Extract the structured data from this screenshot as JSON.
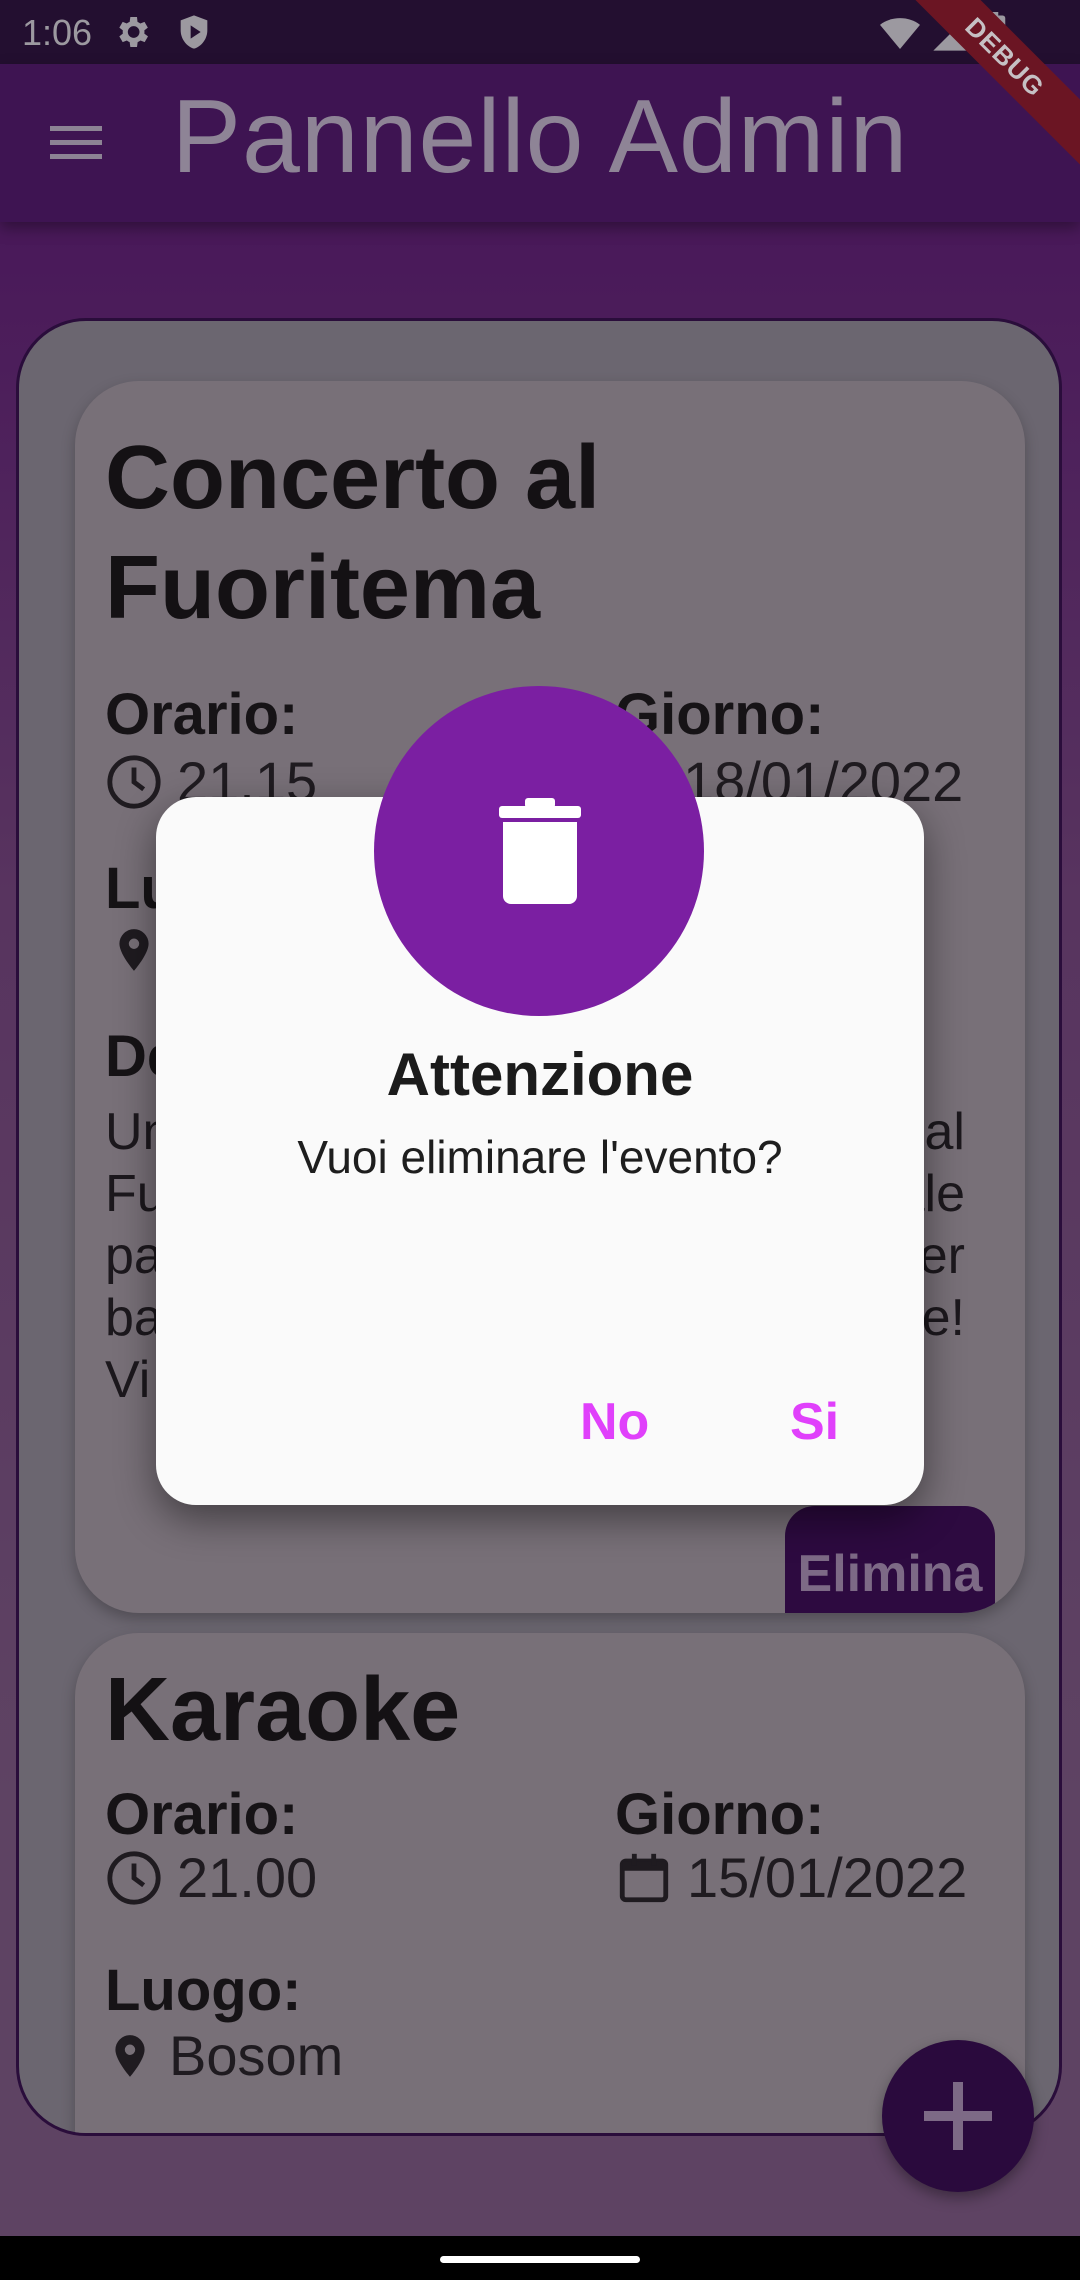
{
  "status_bar": {
    "time": "1:06"
  },
  "debug_banner": "DEBUG",
  "app_bar": {
    "title": "Pannello Admin"
  },
  "events": [
    {
      "title_line1": "Concerto al",
      "title_line2": "Fuoritema",
      "time_label": "Orario:",
      "time": "21.15",
      "day_label": "Giorno:",
      "day": "18/01/2022",
      "place_label": "Lu",
      "desc_label": "De",
      "desc_lines": [
        "Un",
        "Fu",
        "pa",
        "ba",
        "Vi"
      ],
      "desc_right": [
        "al",
        "ale",
        "er",
        "le!"
      ],
      "delete_label": "Elimina"
    },
    {
      "title": "Karaoke",
      "time_label": "Orario:",
      "time": "21.00",
      "day_label": "Giorno:",
      "day": "15/01/2022",
      "place_label": "Luogo:",
      "place": "Bosom"
    }
  ],
  "dialog": {
    "title": "Attenzione",
    "message": "Vuoi eliminare l'evento?",
    "no_label": "No",
    "yes_label": "Si",
    "accent_color": "#7b1fa2",
    "button_color": "#e040fb",
    "icon": "trash-icon"
  }
}
